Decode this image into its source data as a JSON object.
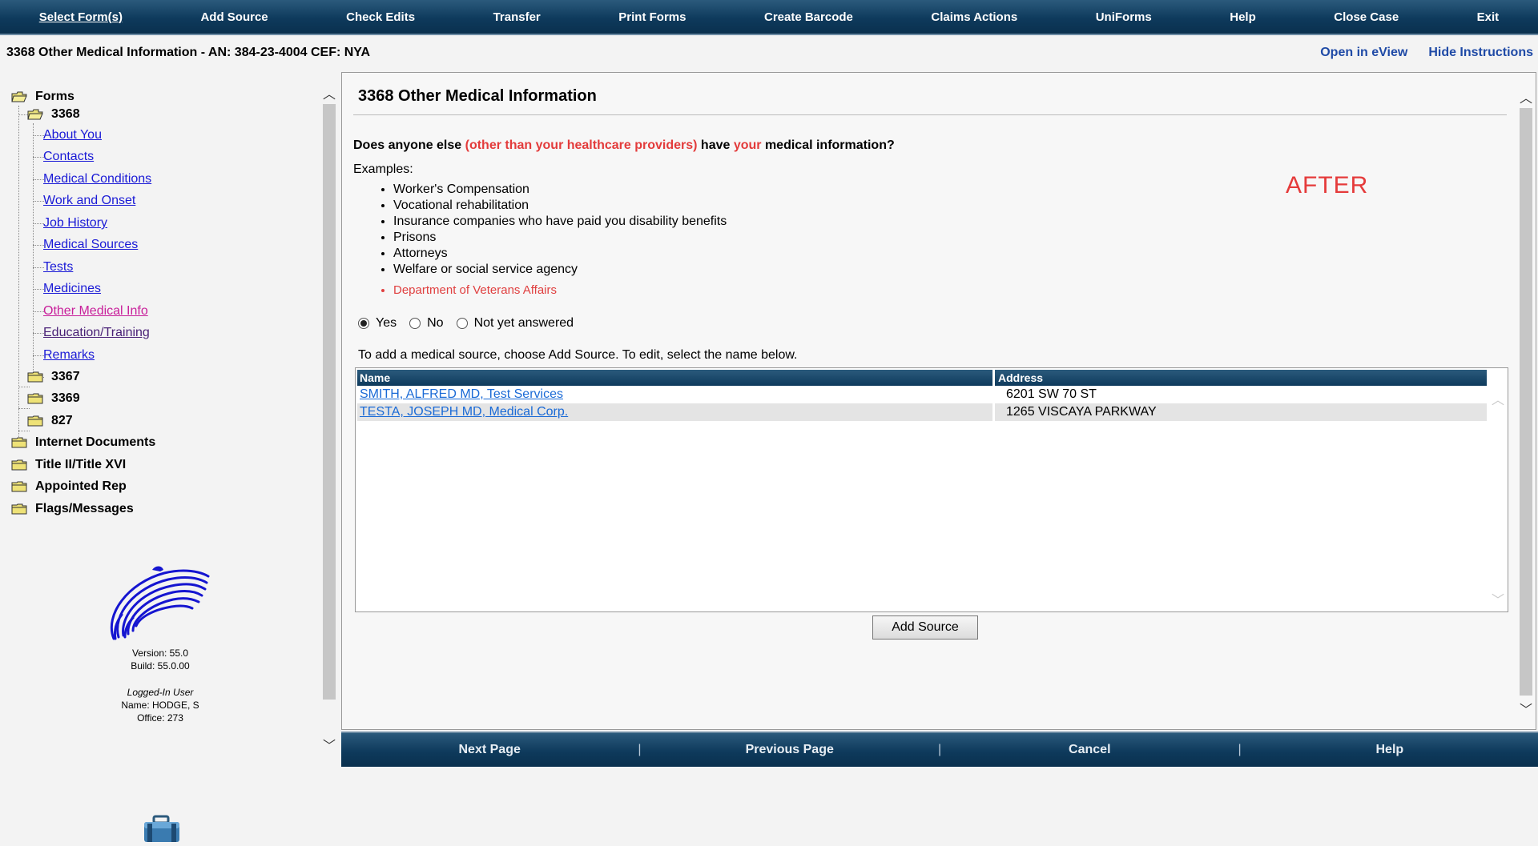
{
  "menu": [
    "Select Form(s)",
    "Add Source",
    "Check Edits",
    "Transfer",
    "Print Forms",
    "Create Barcode",
    "Claims Actions",
    "UniForms",
    "Help",
    "Close Case",
    "Exit"
  ],
  "header": {
    "title": "3368 Other Medical Information - AN: 384-23-4004 CEF: NYA",
    "links": [
      "Open in eView",
      "Hide Instructions"
    ]
  },
  "tree": {
    "forms": "Forms",
    "form_3368": "3368",
    "links": [
      "About You",
      "Contacts",
      "Medical Conditions",
      "Work and Onset",
      "Job History",
      "Medical Sources",
      "Tests",
      "Medicines",
      "Other Medical Info",
      "Education/Training",
      "Remarks"
    ],
    "form_3367": "3367",
    "form_3369": "3369",
    "form_827": "827",
    "internet_documents": "Internet Documents",
    "title_ii_xvi": "Title II/Title XVI",
    "appointed_rep": "Appointed Rep",
    "flags_messages": "Flags/Messages"
  },
  "version": {
    "version": "Version: 55.0",
    "build": "Build: 55.0.00"
  },
  "login": {
    "label": "Logged-In User",
    "name": "Name: HODGE, S",
    "office": "Office: 273"
  },
  "main": {
    "title": "3368 Other Medical Information",
    "question_part1": "Does anyone else ",
    "question_red1": "(other than your healthcare providers)",
    "question_part2": " have ",
    "question_red2": "your",
    "question_part3": " medical information?",
    "examples_label": "Examples:",
    "examples": [
      "Worker's Compensation",
      "Vocational rehabilitation",
      "Insurance companies who have paid you disability benefits",
      "Prisons",
      "Attorneys",
      "Welfare or social service agency"
    ],
    "example_red": "Department of Veterans Affairs",
    "after_label": "AFTER",
    "radios": {
      "yes": "Yes",
      "no": "No",
      "not_yet": "Not yet answered",
      "selected": "yes"
    },
    "instructions": "To add a medical source, choose Add Source. To edit, select the name below.",
    "table": {
      "headers": [
        "Name",
        "Address"
      ],
      "rows": [
        {
          "name": "SMITH, ALFRED MD, Test Services",
          "address": "6201 SW 70 ST"
        },
        {
          "name": "TESTA, JOSEPH MD, Medical Corp.",
          "address": "1265 VISCAYA PARKWAY"
        }
      ]
    },
    "add_source_button": "Add Source"
  },
  "bottom": [
    "Next Page",
    "Previous Page",
    "Cancel",
    "Help"
  ]
}
